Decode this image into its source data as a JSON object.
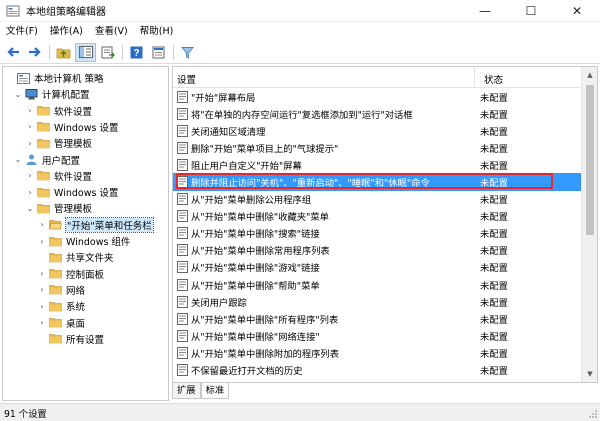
{
  "window": {
    "title": "本地组策略编辑器",
    "minimize_glyph": "—",
    "maximize_glyph": "☐",
    "close_glyph": "✕"
  },
  "menu": [
    "文件(F)",
    "操作(A)",
    "查看(V)",
    "帮助(H)"
  ],
  "toolbar": {
    "icons": [
      "back-icon",
      "forward-icon",
      "up-folder-icon",
      "show-hide-tree-icon",
      "export-list-icon",
      "help-icon",
      "properties-icon",
      "filter-icon"
    ]
  },
  "tree": [
    {
      "label": "本地计算机 策略",
      "level": 0,
      "arrow": "",
      "icon": "computer-policy-icon"
    },
    {
      "label": "计算机配置",
      "level": 1,
      "arrow": "⌄",
      "icon": "computer-icon"
    },
    {
      "label": "软件设置",
      "level": 2,
      "arrow": "›",
      "icon": "folder-icon"
    },
    {
      "label": "Windows 设置",
      "level": 2,
      "arrow": "›",
      "icon": "folder-icon"
    },
    {
      "label": "管理模板",
      "level": 2,
      "arrow": "›",
      "icon": "folder-icon"
    },
    {
      "label": "用户配置",
      "level": 1,
      "arrow": "⌄",
      "icon": "user-icon"
    },
    {
      "label": "软件设置",
      "level": 2,
      "arrow": "›",
      "icon": "folder-icon"
    },
    {
      "label": "Windows 设置",
      "level": 2,
      "arrow": "›",
      "icon": "folder-icon"
    },
    {
      "label": "管理模板",
      "level": 2,
      "arrow": "⌄",
      "icon": "folder-icon"
    },
    {
      "label": "\"开始\"菜单和任务栏",
      "level": 3,
      "arrow": "›",
      "icon": "folder-open-icon",
      "selected": true
    },
    {
      "label": "Windows 组件",
      "level": 3,
      "arrow": "›",
      "icon": "folder-icon"
    },
    {
      "label": "共享文件夹",
      "level": 3,
      "arrow": "",
      "icon": "folder-icon"
    },
    {
      "label": "控制面板",
      "level": 3,
      "arrow": "›",
      "icon": "folder-icon"
    },
    {
      "label": "网络",
      "level": 3,
      "arrow": "›",
      "icon": "folder-icon"
    },
    {
      "label": "系统",
      "level": 3,
      "arrow": "›",
      "icon": "folder-icon"
    },
    {
      "label": "桌面",
      "level": 3,
      "arrow": "›",
      "icon": "folder-icon"
    },
    {
      "label": "所有设置",
      "level": 3,
      "arrow": "",
      "icon": "folder-icon"
    }
  ],
  "list": {
    "col_setting": "设置",
    "col_state": "状态",
    "rows": [
      {
        "name": "\"开始\"屏幕布局",
        "state": "未配置"
      },
      {
        "name": "将\"在单独的内存空间运行\"复选框添加到\"运行\"对话框",
        "state": "未配置"
      },
      {
        "name": "关闭通知区域清理",
        "state": "未配置"
      },
      {
        "name": "删除\"开始\"菜单项目上的\"气球提示\"",
        "state": "未配置"
      },
      {
        "name": "阻止用户自定义\"开始\"屏幕",
        "state": "未配置"
      },
      {
        "name": "删除并阻止访问\"关机\"、\"重新启动\"、\"睡眠\"和\"休眠\"命令",
        "state": "未配置",
        "highlight": true
      },
      {
        "name": "从\"开始\"菜单删除公用程序组",
        "state": "未配置"
      },
      {
        "name": "从\"开始\"菜单中删除\"收藏夹\"菜单",
        "state": "未配置"
      },
      {
        "name": "从\"开始\"菜单中删除\"搜索\"链接",
        "state": "未配置"
      },
      {
        "name": "从\"开始\"菜单中删除常用程序列表",
        "state": "未配置"
      },
      {
        "name": "从\"开始\"菜单中删除\"游戏\"链接",
        "state": "未配置"
      },
      {
        "name": "从\"开始\"菜单中删除\"帮助\"菜单",
        "state": "未配置"
      },
      {
        "name": "关闭用户跟踪",
        "state": "未配置"
      },
      {
        "name": "从\"开始\"菜单中删除\"所有程序\"列表",
        "state": "未配置"
      },
      {
        "name": "从\"开始\"菜单中删除\"网络连接\"",
        "state": "未配置"
      },
      {
        "name": "从\"开始\"菜单中删除附加的程序列表",
        "state": "未配置"
      },
      {
        "name": "不保留最近打开文档的历史",
        "state": "未配置"
      }
    ]
  },
  "tabs": [
    "扩展",
    "标准"
  ],
  "status": "91 个设置",
  "colors": {
    "highlight_bg": "#3399ff",
    "highlight_border": "#e8262e",
    "tree_selected_bg": "#cce8ff",
    "folder": "#e8b94a"
  }
}
